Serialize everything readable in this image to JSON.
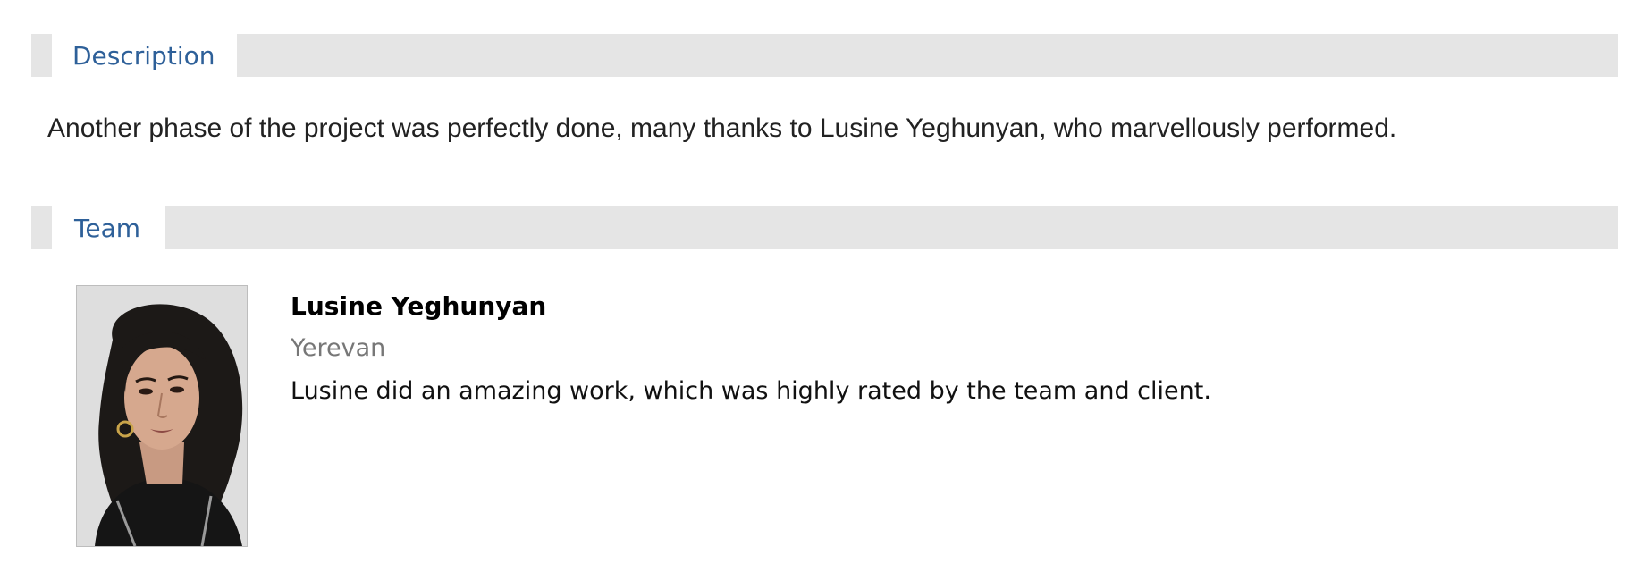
{
  "description": {
    "heading": "Description",
    "text": "Another phase of the project was perfectly done, many thanks to Lusine Yeghunyan, who marvellously performed."
  },
  "team": {
    "heading": "Team",
    "members": [
      {
        "name": "Lusine Yeghunyan",
        "city": "Yerevan",
        "note": "Lusine did an amazing work, which was highly rated by the team and client."
      }
    ]
  },
  "colors": {
    "heading_text": "#2e6099",
    "header_band": "#e5e5e5",
    "city_text": "#777777"
  }
}
